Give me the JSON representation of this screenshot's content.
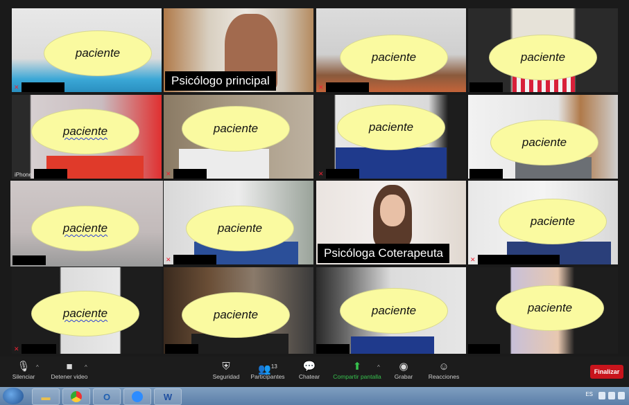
{
  "participants": [
    {
      "label": "paciente",
      "underlined": false
    },
    {
      "label": "Psicólogo principal",
      "therapist": true
    },
    {
      "label": "paciente",
      "underlined": false
    },
    {
      "label": "paciente",
      "underlined": false
    },
    {
      "label": "paciente",
      "underlined": true,
      "device": "iPhone"
    },
    {
      "label": "paciente",
      "underlined": false
    },
    {
      "label": "paciente",
      "underlined": false
    },
    {
      "label": "paciente",
      "underlined": false
    },
    {
      "label": "paciente",
      "underlined": true
    },
    {
      "label": "paciente",
      "underlined": false
    },
    {
      "label": "Psicóloga Coterapeuta",
      "therapist": true
    },
    {
      "label": "paciente",
      "underlined": false
    },
    {
      "label": "paciente",
      "underlined": true
    },
    {
      "label": "paciente",
      "underlined": false
    },
    {
      "label": "paciente",
      "underlined": false
    },
    {
      "label": "paciente",
      "underlined": false
    }
  ],
  "toolbar": {
    "mute": "Silenciar",
    "video": "Detener video",
    "security": "Seguridad",
    "participants": "Participantes",
    "participant_count": "13",
    "chat": "Chatear",
    "share": "Compartir pantalla",
    "record": "Grabar",
    "reactions": "Reacciones",
    "end": "Finalizar"
  },
  "taskbar": {
    "language": "ES",
    "outlook_letter": "O",
    "word_letter": "W"
  },
  "colors": {
    "ellipse": "#fafaa0",
    "active_speaker_border": "#a6d33a",
    "share_green": "#37c24e",
    "end_red": "#c8141c"
  }
}
